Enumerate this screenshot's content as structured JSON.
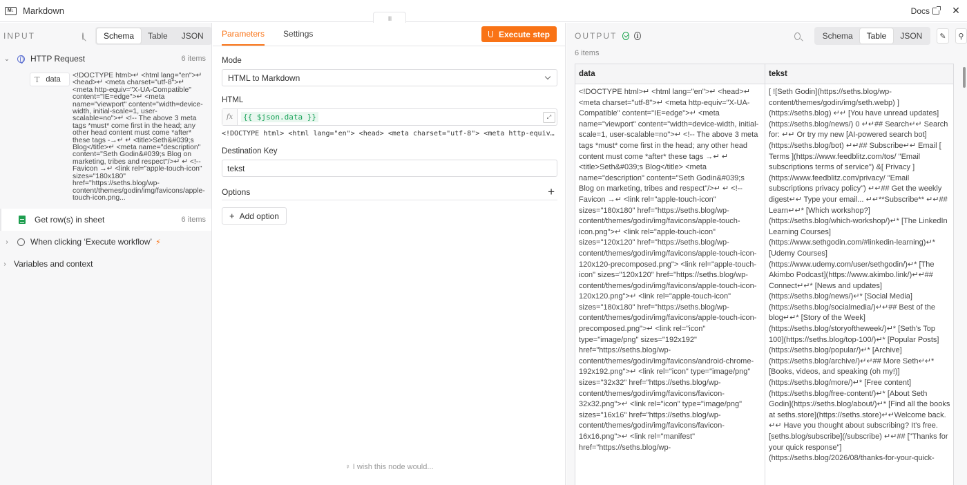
{
  "app": {
    "title": "Markdown",
    "docs_label": "Docs",
    "handle": "III"
  },
  "input": {
    "label": "INPUT",
    "tabs": [
      "Schema",
      "Table",
      "JSON"
    ],
    "active_tab": "Schema",
    "nodes": [
      {
        "name": "HTTP Request",
        "count": "6 items"
      },
      {
        "name": "Get row(s) in sheet",
        "count": "6 items"
      },
      {
        "name": "When clicking ‘Execute workflow’"
      },
      {
        "name": "Variables and context"
      }
    ],
    "field_key": "data",
    "field_value": "<!DOCTYPE html>↵ <html lang=\"en\">↵ <head>↵ <meta charset=\"utf-8\">↵ <meta http-equiv=\"X-UA-Compatible\" content=\"IE=edge\">↵ <meta name=\"viewport\" content=\"width=device-width, initial-scale=1, user-scalable=no\">↵ <!-- The above 3 meta tags *must* come first in the head; any other head content must come *after* these tags -→↵ ↵ <title>Seth&#039;s Blog</title>↵ <meta name=\"description\" content=\"Seth Godin&#039;s Blog on marketing, tribes and respect\"/>↵ ↵ <!-- Favicon →↵ <link rel=\"apple-touch-icon\" sizes=\"180x180\" href=\"https://seths.blog/wp-content/themes/godin/img/favicons/apple-touch-icon.png..."
  },
  "params": {
    "tabs": [
      "Parameters",
      "Settings"
    ],
    "execute_label": "Execute step",
    "mode_label": "Mode",
    "mode_value": "HTML to Markdown",
    "html_label": "HTML",
    "html_expression": "{{ $json.data }}",
    "html_preview": "<!DOCTYPE html> <html lang=\"en\"> <head> <meta charset=\"utf-8\"> <meta http-equiv=\"X-UA-Compatible\" content=\"IE=edge\">",
    "dest_key_label": "Destination Key",
    "dest_key_value": "tekst",
    "options_label": "Options",
    "add_option_label": "Add option",
    "wish_text": "I wish this node would..."
  },
  "output": {
    "label": "OUTPUT",
    "tabs": [
      "Schema",
      "Table",
      "JSON"
    ],
    "active_tab": "Table",
    "items_count": "6 items",
    "columns": [
      "data",
      "tekst"
    ],
    "cell_data": "<!DOCTYPE html>↵ <html lang=\"en\">↵ <head>↵ <meta charset=\"utf-8\">↵ <meta http-equiv=\"X-UA-Compatible\" content=\"IE=edge\">↵ <meta name=\"viewport\" content=\"width=device-width, initial-scale=1, user-scalable=no\">↵ <!-- The above 3 meta tags *must* come first in the head; any other head content must come *after* these tags →↵ ↵ <title>Seth&#039;s Blog</title> <meta name=\"description\" content=\"Seth Godin&#039;s Blog on marketing, tribes and respect\"/>↵ ↵ <!-- Favicon →↵ <link rel=\"apple-touch-icon\" sizes=\"180x180\" href=\"https://seths.blog/wp-content/themes/godin/img/favicons/apple-touch-icon.png\">↵ <link rel=\"apple-touch-icon\" sizes=\"120x120\" href=\"https://seths.blog/wp-content/themes/godin/img/favicons/apple-touch-icon-120x120-precomposed.png\"> <link rel=\"apple-touch-icon\" sizes=\"120x120\" href=\"https://seths.blog/wp-content/themes/godin/img/favicons/apple-touch-icon-120x120.png\">↵ <link rel=\"apple-touch-icon\" sizes=\"180x180\" href=\"https://seths.blog/wp-content/themes/godin/img/favicons/apple-touch-icon-precomposed.png\">↵ <link rel=\"icon\" type=\"image/png\" sizes=\"192x192\" href=\"https://seths.blog/wp-content/themes/godin/img/favicons/android-chrome-192x192.png\">↵ <link rel=\"icon\" type=\"image/png\" sizes=\"32x32\" href=\"https://seths.blog/wp-content/themes/godin/img/favicons/favicon-32x32.png\">↵ <link rel=\"icon\" type=\"image/png\" sizes=\"16x16\" href=\"https://seths.blog/wp-content/themes/godin/img/favicons/favicon-16x16.png\">↵ <link rel=\"manifest\" href=\"https://seths.blog/wp-",
    "cell_tekst": "[ ![Seth Godin](https://seths.blog/wp-content/themes/godin/img/seth.webp) ](https://seths.blog) ↵↵ [You have unread updates](https://seths.blog/news/) 0 ↵↵## Search↵↵ Search for: ↵↵ Or try my new [AI-powered search bot](https://seths.blog/bot) ↵↵## Subscribe↵↵ Email [ Terms ](https://www.feedblitz.com/tos/ \"Email subscriptions terms of service\") &[ Privacy ](https://www.feedblitz.com/privacy/ \"Email subscriptions privacy policy\") ↵↵## Get the weekly digest↵↵ Type your email... ↵↵**Subscribe** ↵↵## Learn↵↵* [Which workshop?](https://seths.blog/which-workshop/)↵* [The LinkedIn Learning Courses](https://www.sethgodin.com/#linkedin-learning)↵* [Udemy Courses](https://www.udemy.com/user/sethgodin/)↵* [The Akimbo Podcast](https://www.akimbo.link/)↵↵## Connect↵↵* [News and updates](https://seths.blog/news/)↵* [Social Media](https://seths.blog/socialmedia/)↵↵## Best of the blog↵↵* [Story of the Week](https://seths.blog/storyoftheweek/)↵* [Seth's Top 100](https://seths.blog/top-100/)↵* [Popular Posts](https://seths.blog/popular/)↵* [Archive](https://seths.blog/archive/)↵↵## More Seth↵↵* [Books, videos, and speaking (oh my!)](https://seths.blog/more/)↵* [Free content](https://seths.blog/free-content/)↵* [About Seth Godin](https://seths.blog/about/)↵* [Find all the books at seths.store](https://seths.store)↵↵Welcome back. ↵↵ Have you thought about subscribing? It's free. [seths.blog/subscribe](/subscribe) ↵↵## [\"Thanks for your quick response\"](https://seths.blog/2026/08/thanks-for-your-quick-"
  },
  "colors": {
    "accent": "#f97316",
    "success": "#16a34a"
  }
}
